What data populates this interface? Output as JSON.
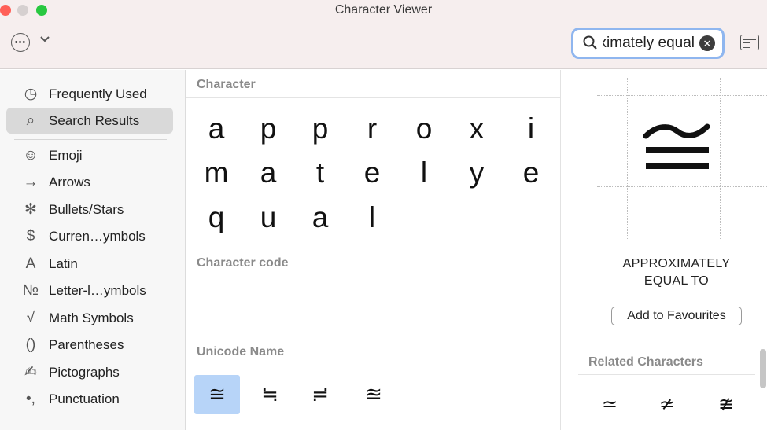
{
  "window": {
    "title": "Character Viewer"
  },
  "toolbar": {
    "more_icon": "ellipsis-circle-icon",
    "search": {
      "value": "approximately equal",
      "placeholder": "Search"
    }
  },
  "sidebar": {
    "items": [
      {
        "label": "Frequently Used",
        "icon": "clock-icon",
        "glyph": "◷"
      },
      {
        "label": "Search Results",
        "icon": "magnifier-icon",
        "glyph": "⌕"
      },
      {
        "label": "Emoji",
        "icon": "smiley-icon",
        "glyph": "☺"
      },
      {
        "label": "Arrows",
        "icon": "arrow-icon",
        "glyph": "→"
      },
      {
        "label": "Bullets/Stars",
        "icon": "asterisk-icon",
        "glyph": "✻"
      },
      {
        "label": "Curren…ymbols",
        "icon": "dollar-icon",
        "glyph": "$"
      },
      {
        "label": "Latin",
        "icon": "latin-a-icon",
        "glyph": "A"
      },
      {
        "label": "Letter-l…ymbols",
        "icon": "numero-icon",
        "glyph": "№"
      },
      {
        "label": "Math Symbols",
        "icon": "square-root-icon",
        "glyph": "√"
      },
      {
        "label": "Parentheses",
        "icon": "parentheses-icon",
        "glyph": "()"
      },
      {
        "label": "Pictographs",
        "icon": "pen-icon",
        "glyph": "✍"
      },
      {
        "label": "Punctuation",
        "icon": "punctuation-icon",
        "glyph": "•,"
      }
    ]
  },
  "main": {
    "character_heading": "Character",
    "characters": [
      "a",
      "p",
      "p",
      "r",
      "o",
      "x",
      "i",
      "m",
      "a",
      "t",
      "e",
      "l",
      "y",
      "e",
      "q",
      "u",
      "a",
      "l"
    ],
    "character_code_heading": "Character code",
    "unicode_name_heading": "Unicode Name",
    "symbols": [
      "≅",
      "≒",
      "≓",
      "≊"
    ]
  },
  "detail": {
    "glyph": "≅",
    "name_line1": "APPROXIMATELY",
    "name_line2": "EQUAL TO",
    "add_button": "Add to Favourites",
    "related_heading": "Related Characters",
    "related": [
      "≃",
      "≄",
      "≇"
    ]
  }
}
